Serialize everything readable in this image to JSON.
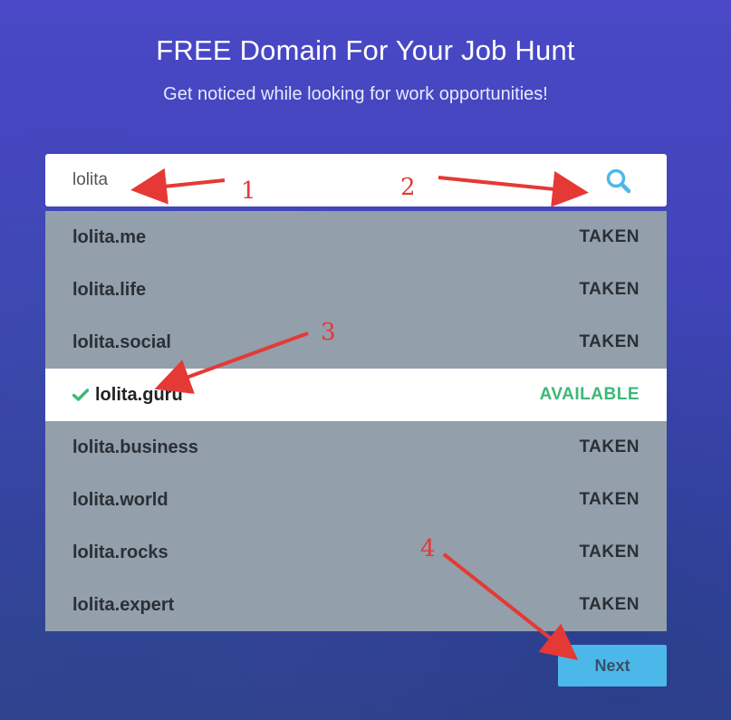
{
  "header": {
    "title": "FREE Domain For Your Job Hunt",
    "subtitle": "Get noticed while looking for work opportunities!"
  },
  "search": {
    "value": "lolita",
    "icon": "search-icon",
    "icon_color": "#4cb8ea"
  },
  "results": [
    {
      "domain": "lolita.me",
      "status": "TAKEN"
    },
    {
      "domain": "lolita.life",
      "status": "TAKEN"
    },
    {
      "domain": "lolita.social",
      "status": "TAKEN"
    },
    {
      "domain": "lolita.guru",
      "status": "AVAILABLE"
    },
    {
      "domain": "lolita.business",
      "status": "TAKEN"
    },
    {
      "domain": "lolita.world",
      "status": "TAKEN"
    },
    {
      "domain": "lolita.rocks",
      "status": "TAKEN"
    },
    {
      "domain": "lolita.expert",
      "status": "TAKEN"
    }
  ],
  "next_button": {
    "label": "Next"
  },
  "annotations": {
    "labels": [
      "1",
      "2",
      "3",
      "4"
    ],
    "color": "#e53935"
  },
  "colors": {
    "available": "#3cb878",
    "taken_row_bg": "#939faa",
    "button_bg": "#4cb8ea"
  }
}
